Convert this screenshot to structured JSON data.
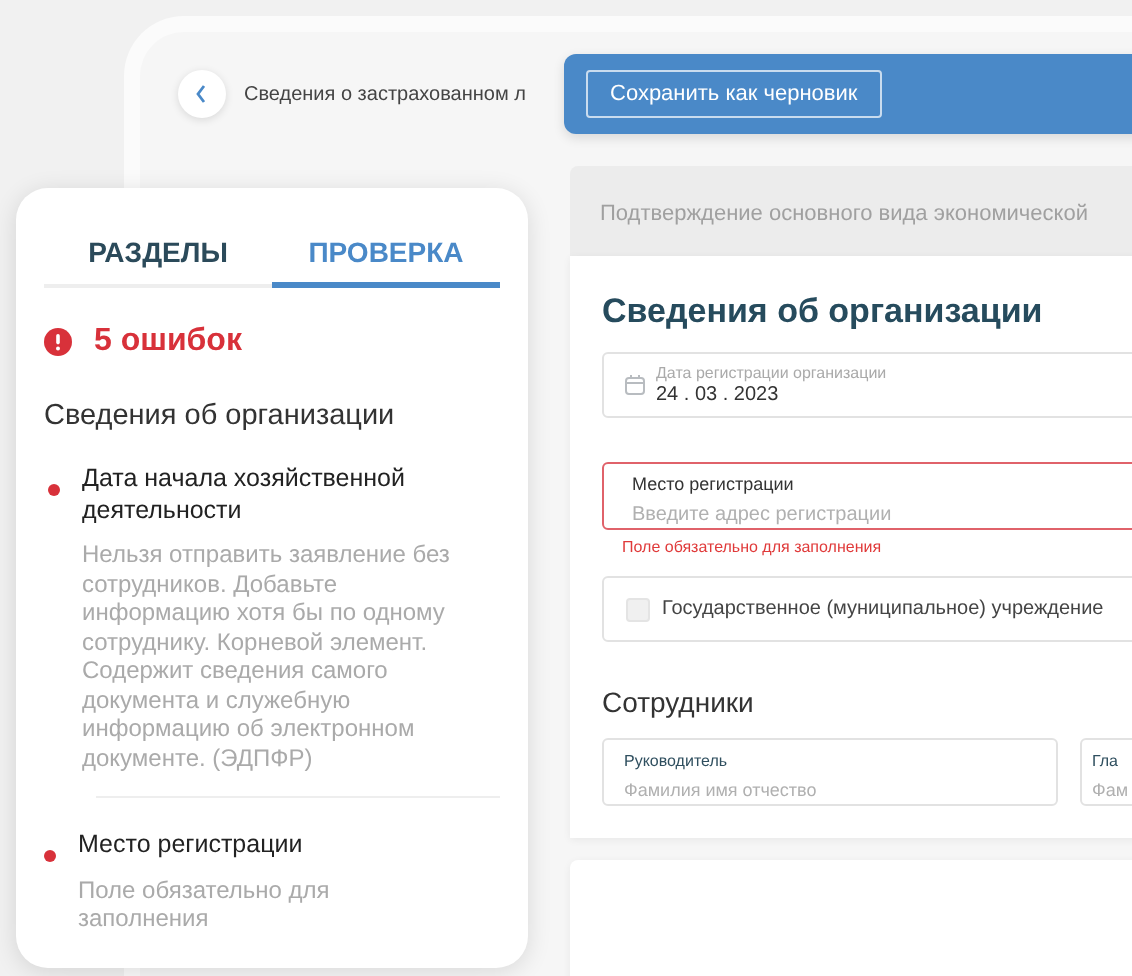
{
  "header": {
    "breadcrumb": "Сведения о застрахованном л",
    "save_draft_button": "Сохранить как черновик"
  },
  "sections": [
    {
      "kind": "collapsed",
      "title": "Подтверждение основного вида экономической"
    },
    {
      "kind": "form",
      "title": "Сведения об организации",
      "fields": [
        {
          "kind": "date",
          "label": "Дата регистрации организации",
          "value": "24 . 03 . 2023"
        },
        {
          "kind": "text",
          "label": "Место регистрации",
          "placeholder": "Введите адрес регистрации",
          "invalid": true,
          "error": "Поле обязательно для заполнения"
        },
        {
          "kind": "checkbox",
          "label": "Государственное (муниципальное) учреждение",
          "checked": false
        }
      ],
      "employees_title": "Сотрудники",
      "employee_fields": [
        {
          "label": "Руководитель",
          "placeholder": "Фамилия имя отчество"
        },
        {
          "label": "Гла",
          "placeholder": "Фам"
        }
      ]
    }
  ],
  "check_panel": {
    "tabs": [
      {
        "label": "РАЗДЕЛЫ",
        "selected": false
      },
      {
        "label": "ПРОВЕРКА",
        "selected": true
      }
    ],
    "error_count": "5 ошибок",
    "group_title": "Сведения об организации",
    "errors": [
      {
        "title": "Дата начала хозяйственной деятельности",
        "description": "Нельзя отправить заявление без сотрудников. Добавьте информацию хотя бы по одному сотруднику. Корневой элемент. Содержит сведения самого документа и служебную информацию об электронном документе. (ЭДПФР)"
      },
      {
        "title": "Место регистрации",
        "description": "Поле обязательно для заполнения"
      }
    ]
  }
}
